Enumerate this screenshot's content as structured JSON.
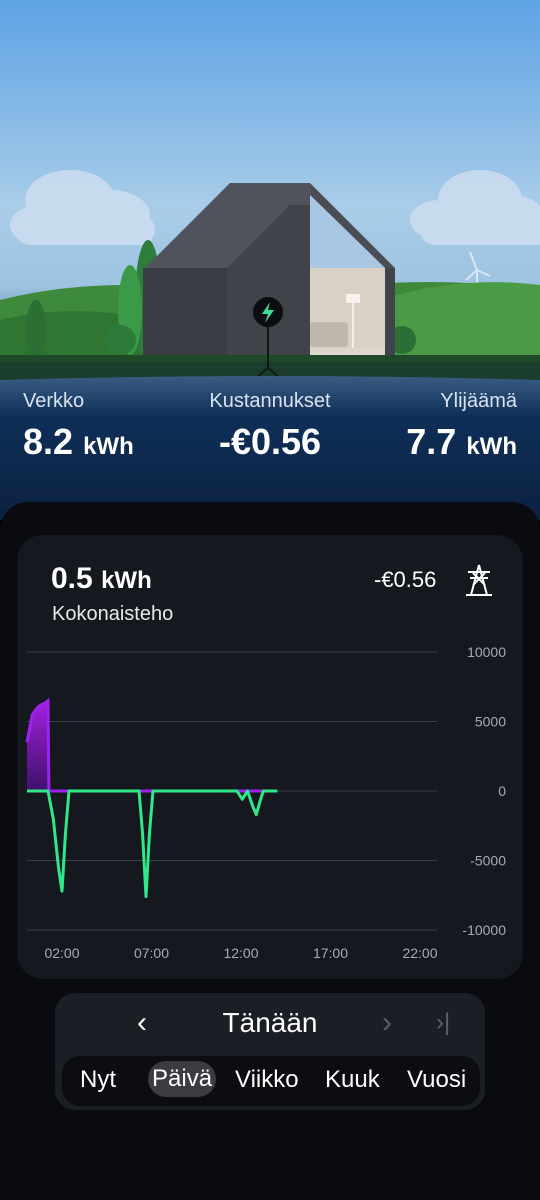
{
  "stats": {
    "grid": {
      "label": "Verkko",
      "value": "8.2",
      "unit": "kWh"
    },
    "cost": {
      "label": "Kustannukset",
      "value": "-€0.56"
    },
    "surplus": {
      "label": "Ylijäämä",
      "value": "7.7",
      "unit": "kWh"
    }
  },
  "summary": {
    "total_value": "0.5",
    "total_unit": "kWh",
    "total_label": "Kokonaisteho",
    "cost": "-€0.56",
    "grid_icon": "power-pylon-icon"
  },
  "chart_data": {
    "type": "line",
    "y_ticks": [
      "10000",
      "5000",
      "0",
      "-5000",
      "-10000"
    ],
    "ylim": [
      -10000,
      10000
    ],
    "x_ticks": [
      "02:00",
      "07:00",
      "12:00",
      "17:00",
      "22:00"
    ],
    "grid": true,
    "series": [
      {
        "color": "#a020f0",
        "x": [
          0.0,
          0.3,
          0.6,
          0.8,
          1.0,
          1.2,
          1.25,
          1.3,
          14.3
        ],
        "y": [
          3500,
          5500,
          6000,
          6200,
          6300,
          6500,
          0,
          0,
          0
        ]
      },
      {
        "color": "#2ee88a",
        "x": [
          0.0,
          1.2,
          1.5,
          1.8,
          2.0,
          2.2,
          2.4,
          2.8,
          6.4,
          6.6,
          6.8,
          7.0,
          7.2,
          7.5,
          8.0,
          12.0,
          12.3,
          12.6,
          12.9,
          13.1,
          13.3,
          13.5,
          14.3
        ],
        "y": [
          0,
          0,
          -2000,
          -5500,
          -7200,
          -3000,
          0,
          0,
          0,
          -3000,
          -7600,
          -3000,
          0,
          0,
          0,
          0,
          -600,
          0,
          -1100,
          -1700,
          -800,
          0,
          0
        ]
      }
    ]
  },
  "navigation": {
    "prev_icon": "chevron-left-icon",
    "date_label": "Tänään",
    "next_icon": "chevron-right-icon",
    "last_icon": "skip-to-end-icon",
    "periods": [
      "Nyt",
      "Päivä",
      "Viikko",
      "Kuuk",
      "Vuosi"
    ],
    "active_period": "Päivä"
  },
  "colors": {
    "import": "#a020f0",
    "export": "#2ee88a",
    "bolt_badge": "#3ddc97"
  }
}
